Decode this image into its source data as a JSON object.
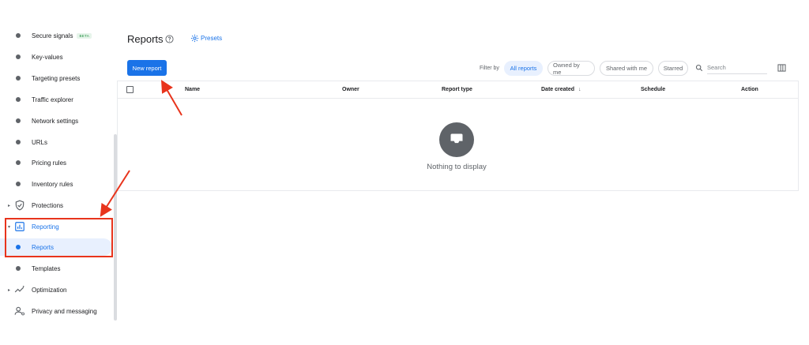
{
  "sidebar": {
    "items": [
      {
        "label": "Secure signals",
        "badge": "BETA"
      },
      {
        "label": "Key-values"
      },
      {
        "label": "Targeting presets"
      },
      {
        "label": "Traffic explorer"
      },
      {
        "label": "Network settings"
      },
      {
        "label": "URLs"
      },
      {
        "label": "Pricing rules"
      },
      {
        "label": "Inventory rules"
      },
      {
        "label": "Protections",
        "icon": "shield-icon"
      },
      {
        "label": "Reporting",
        "icon": "bar-chart-icon"
      },
      {
        "label": "Reports"
      },
      {
        "label": "Templates"
      },
      {
        "label": "Optimization",
        "icon": "trending-icon"
      },
      {
        "label": "Privacy and messaging",
        "icon": "person-settings-icon"
      }
    ]
  },
  "header": {
    "title": "Reports",
    "presets_label": "Presets"
  },
  "toolbar": {
    "new_report_label": "New report",
    "filter_by_label": "Filter by",
    "chips": [
      "All reports",
      "Owned by me",
      "Shared with me",
      "Starred"
    ],
    "search_placeholder": "Search"
  },
  "table": {
    "columns": [
      "Name",
      "Owner",
      "Report type",
      "Date created",
      "Schedule",
      "Action"
    ],
    "empty_message": "Nothing to display"
  },
  "colors": {
    "accent": "#1a73e8",
    "annotation": "#e8341c",
    "selected_bg": "#e8f0fe"
  }
}
